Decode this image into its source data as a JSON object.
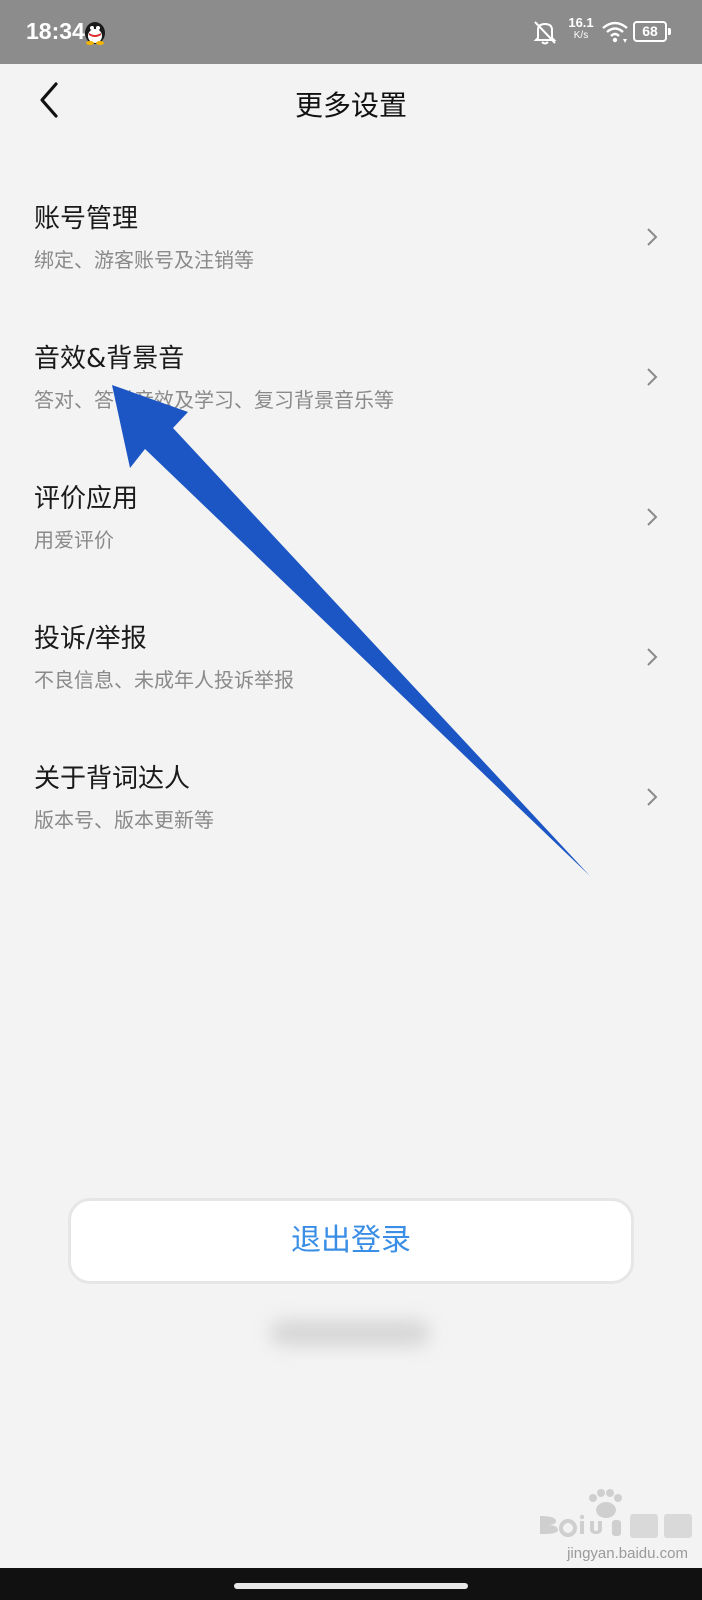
{
  "status_bar": {
    "time": "18:34",
    "net_speed_value": "16.1",
    "net_speed_unit": "K/s",
    "battery": "68",
    "icons": [
      "qq-icon",
      "bell-off-icon",
      "wifi-icon",
      "battery-icon"
    ]
  },
  "header": {
    "title": "更多设置"
  },
  "settings": {
    "items": [
      {
        "title": "账号管理",
        "subtitle": "绑定、游客账号及注销等"
      },
      {
        "title": "音效&背景音",
        "subtitle": "答对、答错音效及学习、复习背景音乐等"
      },
      {
        "title": "评价应用",
        "subtitle": "用爱评价"
      },
      {
        "title": "投诉/举报",
        "subtitle": "不良信息、未成年人投诉举报"
      },
      {
        "title": "关于背词达人",
        "subtitle": "版本号、版本更新等"
      }
    ]
  },
  "logout": {
    "label": "退出登录"
  },
  "watermark": {
    "logo_text": "Baidu经验",
    "url": "jingyan.baidu.com"
  },
  "colors": {
    "status_bar_bg": "#8c8c8c",
    "page_bg": "#f3f3f3",
    "accent_blue": "#3a8ee6",
    "annotation_arrow": "#1c56c4"
  }
}
